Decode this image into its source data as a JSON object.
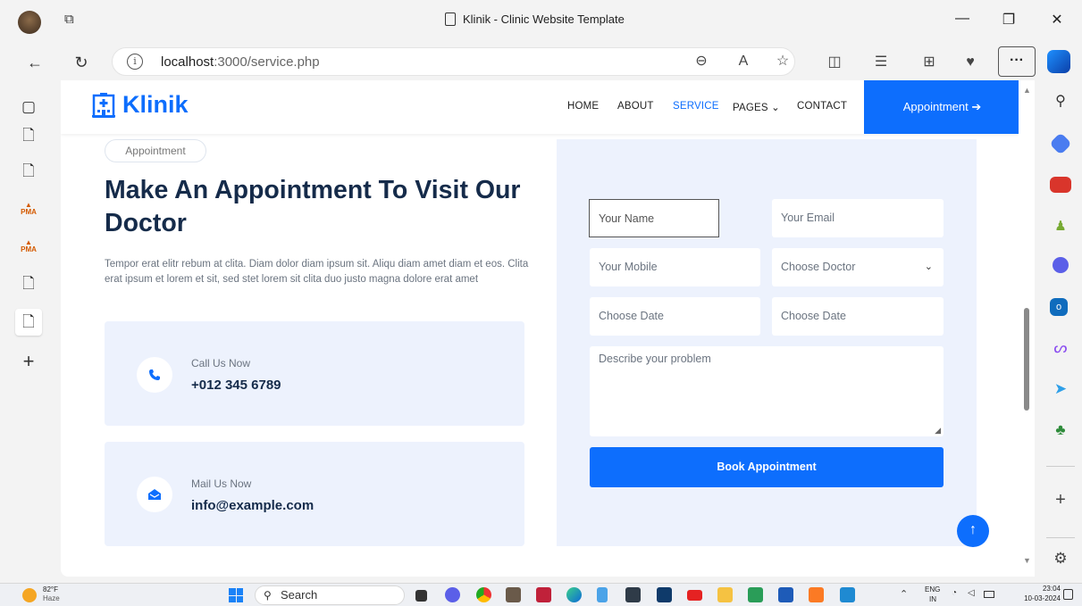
{
  "browser": {
    "tab_title": "Klinik - Clinic Website Template",
    "url_host": "localhost",
    "url_path": ":3000/service.php",
    "more_label": "···"
  },
  "site": {
    "brand": "Klinik",
    "nav": [
      {
        "label": "HOME"
      },
      {
        "label": "ABOUT"
      },
      {
        "label": "SERVICE",
        "active": true
      },
      {
        "label": "PAGES ⌄"
      },
      {
        "label": "CONTACT"
      }
    ],
    "appointment_button": "Appointment ➔"
  },
  "content": {
    "pill": "Appointment",
    "heading": "Make An Appointment To Visit Our Doctor",
    "paragraph": "Tempor erat elitr rebum at clita. Diam dolor diam ipsum sit. Aliqu diam amet diam et eos. Clita erat ipsum et lorem et sit, sed stet lorem sit clita duo justo magna dolore erat amet",
    "call": {
      "label": "Call Us Now",
      "value": "+012 345 6789"
    },
    "mail": {
      "label": "Mail Us Now",
      "value": "info@example.com"
    }
  },
  "form": {
    "name_placeholder": "Your Name",
    "email_placeholder": "Your Email",
    "mobile_placeholder": "Your Mobile",
    "doctor_select": "Choose Doctor",
    "date_placeholder": "Choose Date",
    "date2_placeholder": "Choose Date",
    "problem_placeholder": "Describe your problem",
    "submit": "Book Appointment"
  },
  "taskbar": {
    "weather_temp": "82°F",
    "weather_desc": "Haze",
    "search": "Search",
    "lang": "ENG",
    "region": "IN",
    "time": "23:04",
    "date": "10-03-2024"
  },
  "colors": {
    "accent": "#0d6efd",
    "heading": "#152b4a",
    "panel": "#edf2fd"
  }
}
